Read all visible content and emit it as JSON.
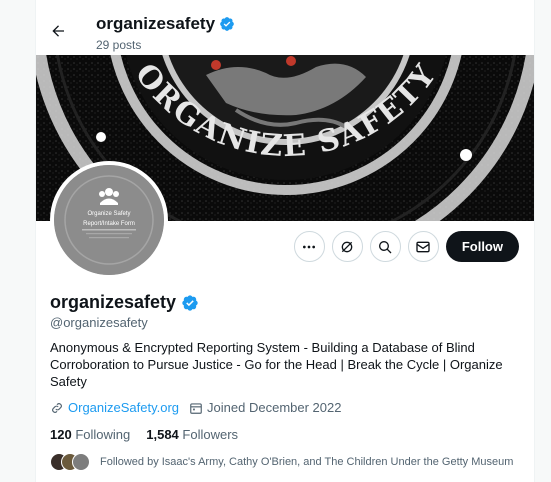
{
  "header": {
    "name": "organizesafety",
    "posts": "29 posts"
  },
  "banner": {
    "text": "ORGANIZE SAFETY"
  },
  "avatar": {
    "line1": "Organize Safety",
    "line2": "Report/Intake Form"
  },
  "actions": {
    "follow_label": "Follow"
  },
  "profile": {
    "name": "organizesafety",
    "handle": "@organizesafety",
    "bio": "Anonymous & Encrypted Reporting System - Building a Database of Blind Corroboration to Pursue Justice - Go for the Head | Break the Cycle | Organize Safety",
    "website": "OrganizeSafety.org",
    "joined": "Joined December 2022"
  },
  "counts": {
    "following_num": "120",
    "following_label": "Following",
    "followers_num": "1,584",
    "followers_label": "Followers"
  },
  "followed_by": "Followed by Isaac's Army, Cathy O'Brien, and The Children Under the Getty Museum",
  "colors": {
    "accent": "#1d9bf0",
    "text": "#0f1419",
    "muted": "#536471",
    "border": "#cfd9de"
  }
}
